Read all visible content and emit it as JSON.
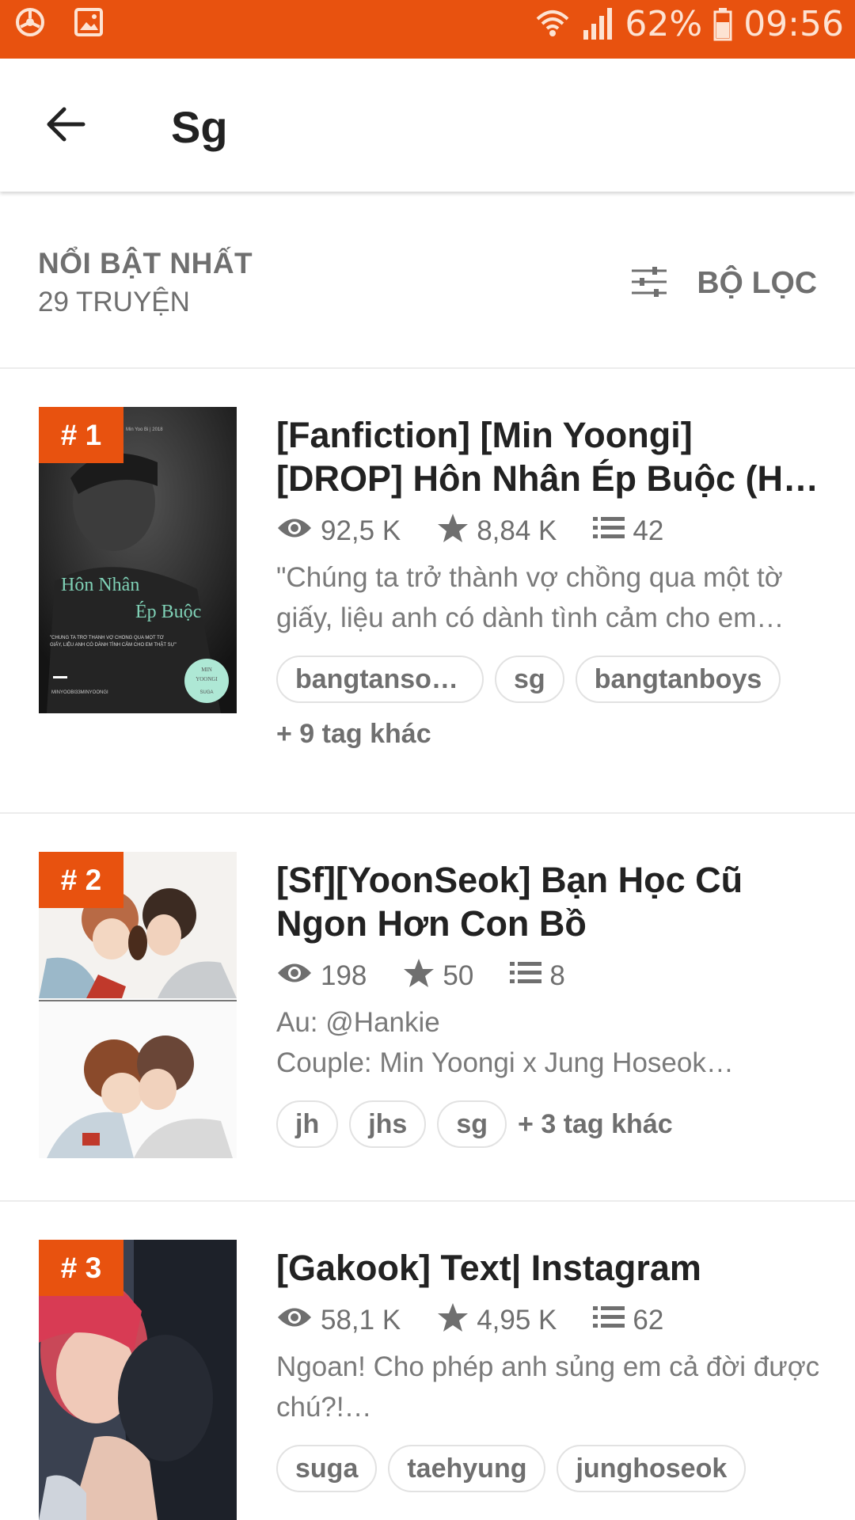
{
  "status_bar": {
    "battery": "62%",
    "time": "09:56",
    "bg_color": "#e8520f"
  },
  "app_bar": {
    "title": "Sg",
    "back_icon": "arrow-left-icon"
  },
  "list_header": {
    "sort": "NỔI BẬT NHẤT",
    "count": "29 TRUYỆN",
    "filter_label": "BỘ LỌC",
    "filter_icon": "sliders-icon"
  },
  "accent_color": "#e8520f",
  "stories": [
    {
      "rank": "# 1",
      "title": "[Fanfiction] [Min Yoongi] [DROP] Hôn Nhân Ép Buộc (H…",
      "reads": "92,5 K",
      "votes": "8,84 K",
      "parts": "42",
      "desc": "\"Chúng ta trở thành vợ chồng qua một tờ giấy, liệu anh có dành tình cảm cho em…",
      "tags": [
        "bangtanso…",
        "sg",
        "bangtanboys"
      ],
      "more_tags": "+ 9 tag khác",
      "cover_text": {
        "top_line": "Min Yoo Bi | 2018",
        "title_1": "Hôn Nhân",
        "title_2": "Ép Buộc",
        "quote": "\"CHÚNG TA TRỞ THÀNH VỢ CHỒNG QUA MỘT TỜ GIẤY, LIỆU ANH CÓ DÀNH TÌNH CẢM CHO EM THẬT SỰ\"",
        "author": "MINYOOBI33MINYOONGI",
        "badge_1": "MIN",
        "badge_2": "YOONGI",
        "badge_3": "SUGA"
      }
    },
    {
      "rank": "# 2",
      "title": "[Sf][YoonSeok] Bạn Học Cũ Ngon Hơn Con Bồ",
      "reads": "198",
      "votes": "50",
      "parts": "8",
      "desc_line1": "Au: @Hankie",
      "desc_line2": "Couple: Min Yoongi x Jung Hoseok…",
      "tags": [
        "jh",
        "jhs",
        "sg"
      ],
      "more_tags": "+ 3 tag khác"
    },
    {
      "rank": "# 3",
      "title": "[Gakook] Text| Instagram",
      "reads": "58,1 K",
      "votes": "4,95 K",
      "parts": "62",
      "desc": "Ngoan! Cho phép anh sủng em cả đời được chú?!…",
      "tags": [
        "suga",
        "taehyung",
        "junghoseok"
      ]
    }
  ]
}
